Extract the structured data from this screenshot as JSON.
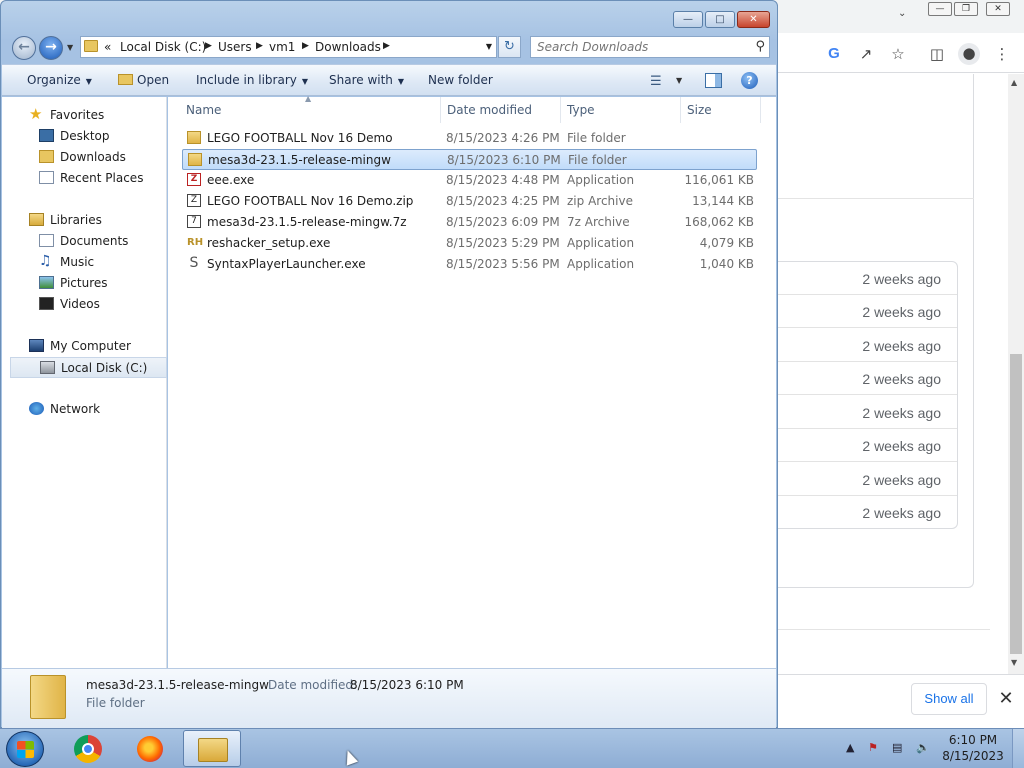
{
  "chrome": {
    "window_controls": [
      "—",
      "❐",
      "✕"
    ],
    "list_items": [
      "2 weeks ago",
      "2 weeks ago",
      "2 weeks ago",
      "2 weeks ago",
      "2 weeks ago",
      "2 weeks ago",
      "2 weeks ago",
      "2 weeks ago"
    ],
    "downloads_bar": {
      "show_all_label": "Show all",
      "close_glyph": "✕"
    }
  },
  "explorer": {
    "address": {
      "overflow": "«",
      "crumbs": [
        "Local Disk (C:)",
        "Users",
        "vm1",
        "Downloads"
      ],
      "separator": "▶"
    },
    "search": {
      "placeholder": "Search Downloads"
    },
    "toolbar": {
      "organize": "Organize",
      "open": "Open",
      "include_in_library": "Include in library",
      "share_with": "Share with",
      "new_folder": "New folder"
    },
    "nav": {
      "favorites": "Favorites",
      "desktop": "Desktop",
      "downloads": "Downloads",
      "recent_places": "Recent Places",
      "libraries": "Libraries",
      "documents": "Documents",
      "music": "Music",
      "pictures": "Pictures",
      "videos": "Videos",
      "my_computer": "My Computer",
      "local_disk": "Local Disk (C:)",
      "network": "Network"
    },
    "columns": {
      "name": "Name",
      "date": "Date modified",
      "type": "Type",
      "size": "Size"
    },
    "files": [
      {
        "name": "LEGO FOOTBALL Nov 16 Demo",
        "date": "8/15/2023 4:26 PM",
        "type": "File folder",
        "size": ""
      },
      {
        "name": "mesa3d-23.1.5-release-mingw",
        "date": "8/15/2023 6:10 PM",
        "type": "File folder",
        "size": ""
      },
      {
        "name": "eee.exe",
        "date": "8/15/2023 4:48 PM",
        "type": "Application",
        "size": "116,061 KB"
      },
      {
        "name": "LEGO FOOTBALL Nov 16 Demo.zip",
        "date": "8/15/2023 4:25 PM",
        "type": "zip Archive",
        "size": "13,144 KB"
      },
      {
        "name": "mesa3d-23.1.5-release-mingw.7z",
        "date": "8/15/2023 6:09 PM",
        "type": "7z Archive",
        "size": "168,062 KB"
      },
      {
        "name": "reshacker_setup.exe",
        "date": "8/15/2023 5:29 PM",
        "type": "Application",
        "size": "4,079 KB"
      },
      {
        "name": "SyntaxPlayerLauncher.exe",
        "date": "8/15/2023 5:56 PM",
        "type": "Application",
        "size": "1,040 KB"
      }
    ],
    "details": {
      "name": "mesa3d-23.1.5-release-mingw",
      "modified_label": "Date modified:",
      "modified_value": "8/15/2023 6:10 PM",
      "type": "File folder"
    }
  },
  "taskbar": {
    "clock_time": "6:10 PM",
    "clock_date": "8/15/2023"
  }
}
